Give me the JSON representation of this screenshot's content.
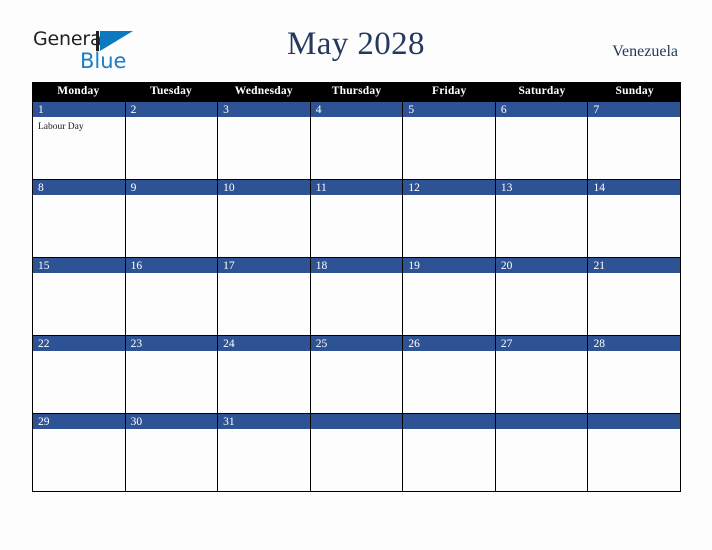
{
  "brand": {
    "word_general": "General",
    "word_blue": "Blue",
    "mark_name": "triangle-logo-mark"
  },
  "header": {
    "title": "May 2028",
    "country": "Venezuela"
  },
  "calendar": {
    "weekday_headers": [
      "Monday",
      "Tuesday",
      "Wednesday",
      "Thursday",
      "Friday",
      "Saturday",
      "Sunday"
    ],
    "colors": {
      "header_bar": "#000000",
      "date_bar": "#2e5395",
      "title_text": "#23395f",
      "brand_blue": "#1b7ec6",
      "cell_background": "#fdfdfd",
      "grid_line": "#000000"
    },
    "weeks": [
      [
        {
          "date": "1",
          "events": [
            "Labour Day"
          ]
        },
        {
          "date": "2",
          "events": []
        },
        {
          "date": "3",
          "events": []
        },
        {
          "date": "4",
          "events": []
        },
        {
          "date": "5",
          "events": []
        },
        {
          "date": "6",
          "events": []
        },
        {
          "date": "7",
          "events": []
        }
      ],
      [
        {
          "date": "8",
          "events": []
        },
        {
          "date": "9",
          "events": []
        },
        {
          "date": "10",
          "events": []
        },
        {
          "date": "11",
          "events": []
        },
        {
          "date": "12",
          "events": []
        },
        {
          "date": "13",
          "events": []
        },
        {
          "date": "14",
          "events": []
        }
      ],
      [
        {
          "date": "15",
          "events": []
        },
        {
          "date": "16",
          "events": []
        },
        {
          "date": "17",
          "events": []
        },
        {
          "date": "18",
          "events": []
        },
        {
          "date": "19",
          "events": []
        },
        {
          "date": "20",
          "events": []
        },
        {
          "date": "21",
          "events": []
        }
      ],
      [
        {
          "date": "22",
          "events": []
        },
        {
          "date": "23",
          "events": []
        },
        {
          "date": "24",
          "events": []
        },
        {
          "date": "25",
          "events": []
        },
        {
          "date": "26",
          "events": []
        },
        {
          "date": "27",
          "events": []
        },
        {
          "date": "28",
          "events": []
        }
      ],
      [
        {
          "date": "29",
          "events": []
        },
        {
          "date": "30",
          "events": []
        },
        {
          "date": "31",
          "events": []
        },
        {
          "date": "",
          "events": []
        },
        {
          "date": "",
          "events": []
        },
        {
          "date": "",
          "events": []
        },
        {
          "date": "",
          "events": []
        }
      ]
    ]
  }
}
